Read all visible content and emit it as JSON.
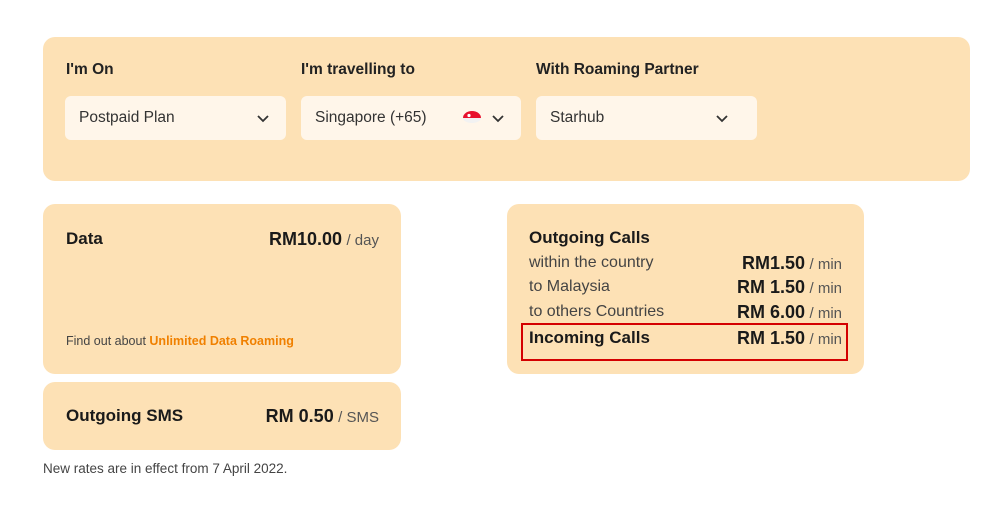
{
  "selectors": {
    "plan": {
      "label": "I'm On",
      "value": "Postpaid Plan"
    },
    "destination": {
      "label": "I'm travelling to",
      "value": "Singapore (+65)",
      "flag": "singapore-flag-icon"
    },
    "partner": {
      "label": "With Roaming Partner",
      "value": "Starhub"
    }
  },
  "data_card": {
    "title": "Data",
    "price": "RM10.00",
    "unit": "/ day",
    "find_out_text": "Find out about",
    "link_text": "Unlimited Data Roaming"
  },
  "sms_card": {
    "title": "Outgoing SMS",
    "price": "RM 0.50",
    "unit": "/ SMS"
  },
  "calls_card": {
    "title": "Outgoing Calls",
    "rows": [
      {
        "label": "within the country",
        "price": "RM1.50",
        "unit": "/ min"
      },
      {
        "label": "to Malaysia",
        "price": "RM 1.50",
        "unit": "/ min"
      },
      {
        "label": "to others Countries",
        "price": "RM 6.00",
        "unit": "/ min"
      }
    ],
    "incoming": {
      "label": "Incoming Calls",
      "price": "RM 1.50",
      "unit": "/ min"
    }
  },
  "footnote": "New rates are in effect from 7 April 2022.",
  "colors": {
    "panel": "#fde1b5",
    "link": "#f08000",
    "highlight": "#d40000"
  }
}
